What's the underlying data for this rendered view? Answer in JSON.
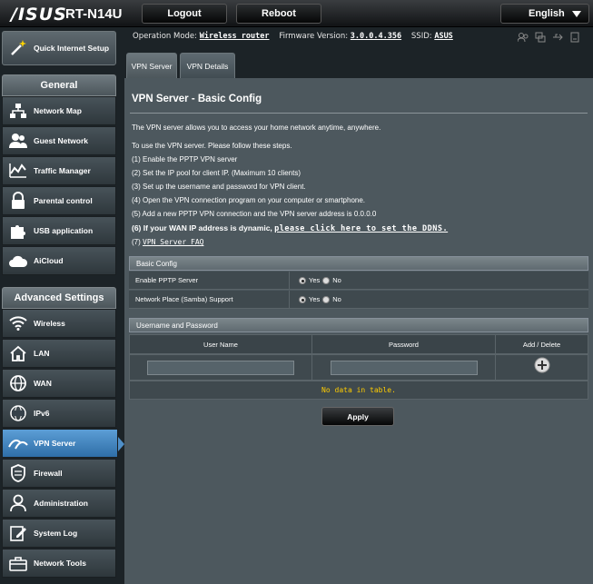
{
  "brand": {
    "logo": "/ISUS",
    "model": "RT-N14U"
  },
  "topbar": {
    "logout": "Logout",
    "reboot": "Reboot",
    "language": "English"
  },
  "sidebar": {
    "quick_setup": "Quick Internet Setup",
    "general_header": "General",
    "general_items": [
      "Network Map",
      "Guest Network",
      "Traffic Manager",
      "Parental control",
      "USB application",
      "AiCloud"
    ],
    "advanced_header": "Advanced Settings",
    "advanced_items": [
      "Wireless",
      "LAN",
      "WAN",
      "IPv6",
      "VPN Server",
      "Firewall",
      "Administration",
      "System Log",
      "Network Tools"
    ],
    "active": "VPN Server"
  },
  "status": {
    "op_mode_label": "Operation Mode:",
    "op_mode": "Wireless router",
    "fw_label": "Firmware Version:",
    "fw": "3.0.0.4.356",
    "ssid_label": "SSID:",
    "ssid": "ASUS"
  },
  "tabs": [
    "VPN Server",
    "VPN Details"
  ],
  "page": {
    "title": "VPN Server - Basic Config",
    "intro": "The VPN server allows you to access your home network anytime, anywhere.",
    "steps_intro": "To use the VPN server. Please follow these steps.",
    "steps": [
      "(1) Enable the PPTP VPN server",
      "(2) Set the IP pool for client IP. (Maximum 10 clients)",
      "(3) Set up the username and password for VPN client.",
      "(4) Open the VPN connection program on your computer or smartphone.",
      "(5) Add a new PPTP VPN connection and the VPN server address is 0.0.0.0"
    ],
    "step6_text": "(6) If your WAN IP address is dynamic,",
    "step6_link": "please click here to set the DDNS.",
    "step7_prefix": "(7)",
    "step7_link": "VPN Server FAQ"
  },
  "basic_config": {
    "header": "Basic Config",
    "rows": [
      {
        "label": "Enable PPTP Server",
        "yes": "Yes",
        "no": "No",
        "selected": "Yes"
      },
      {
        "label": "Network Place (Samba) Support",
        "yes": "Yes",
        "no": "No",
        "selected": "Yes"
      }
    ]
  },
  "users": {
    "header": "Username and Password",
    "col_user": "User Name",
    "col_pass": "Password",
    "col_action": "Add / Delete",
    "user_value": "",
    "pass_value": "",
    "empty": "No data in table."
  },
  "apply": "Apply"
}
